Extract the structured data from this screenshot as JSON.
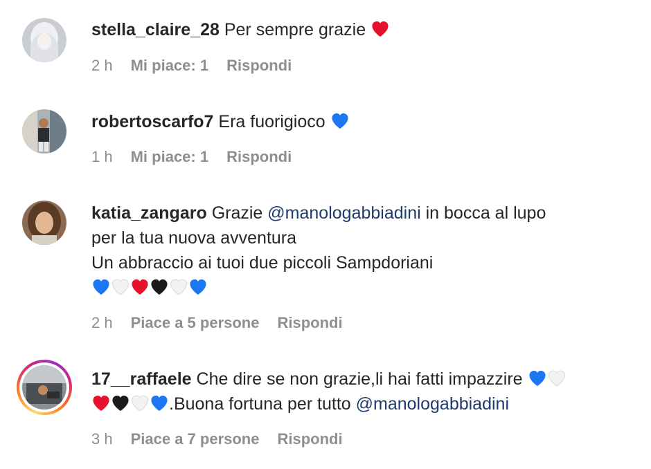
{
  "comments": [
    {
      "username": "stella_claire_28",
      "text": "Per sempre grazie",
      "emoji_after": [
        "red"
      ],
      "time": "2 h",
      "likes": "Mi piace: 1",
      "reply": "Rispondi"
    },
    {
      "username": "robertoscarfo7",
      "text": "Era fuorigioco",
      "emoji_after": [
        "blue"
      ],
      "time": "1 h",
      "likes": "Mi piace: 1",
      "reply": "Rispondi"
    },
    {
      "username": "katia_zangaro",
      "text_before": "Grazie",
      "mention": "@manologabbiadini",
      "text_after": "in bocca al lupo",
      "line2": "per la tua nuova avventura",
      "line3": "Un abbraccio ai tuoi due piccoli Sampdoriani",
      "emoji_line": [
        "blue",
        "white",
        "red",
        "black",
        "white",
        "blue"
      ],
      "time": "2 h",
      "likes": "Piace a 5 persone",
      "reply": "Rispondi"
    },
    {
      "username": "17__raffaele",
      "text": "Che dire se non grazie,li hai fatti impazzire",
      "emoji_after": [
        "blue",
        "white"
      ],
      "emoji_line_start": [
        "red",
        "black",
        "white",
        "blue"
      ],
      "line2": ".Buona fortuna per tutto",
      "mention": "@manologabbiadini",
      "time": "3 h",
      "likes": "Piace a 7 persone",
      "reply": "Rispondi"
    }
  ],
  "colors": {
    "red": "#e8112d",
    "blue": "#1d77f2",
    "black": "#1a1a1a",
    "white": "#f2f2f2",
    "meta": "#8e8e8e",
    "mention": "#1f3b6e"
  }
}
